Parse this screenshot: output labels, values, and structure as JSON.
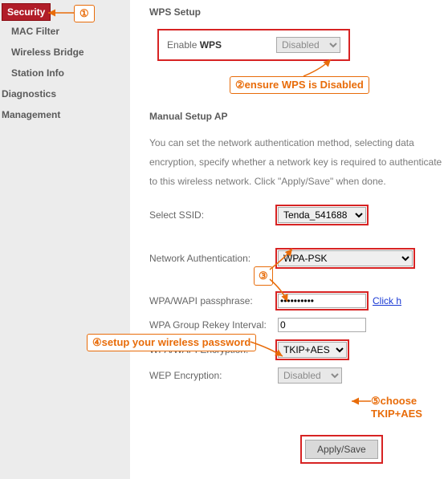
{
  "sidebar": {
    "items": [
      {
        "label": "Security",
        "active": true
      },
      {
        "label": "MAC Filter"
      },
      {
        "label": "Wireless Bridge"
      },
      {
        "label": "Station Info"
      },
      {
        "label": "Diagnostics",
        "top": true
      },
      {
        "label": "Management",
        "top": true
      }
    ]
  },
  "wps": {
    "heading": "WPS Setup",
    "enable_label_prefix": "Enable ",
    "enable_label_bold": "WPS",
    "select_value": "Disabled"
  },
  "manual": {
    "heading": "Manual Setup AP",
    "body": "You can set the network authentication method, selecting data encryption, specify whether a network key is required to authenticate to this wireless network. Click \"Apply/Save\" when done."
  },
  "form": {
    "ssid_label": "Select SSID:",
    "ssid_value": "Tenda_541688",
    "auth_label": "Network Authentication:",
    "auth_value": "WPA-PSK",
    "pass_label": "WPA/WAPI passphrase:",
    "pass_value": "••••••••••",
    "pass_hint": "Click h",
    "rekey_label": "WPA Group Rekey Interval:",
    "rekey_value": "0",
    "enc_label": "WPA/WAPI Encryption:",
    "enc_value": "TKIP+AES",
    "wep_label": "WEP Encryption:",
    "wep_value": "Disabled"
  },
  "apply_label": "Apply/Save",
  "annotations": {
    "step1": "①",
    "step2_text": "②ensure WPS is Disabled",
    "step3": "③",
    "step4_text": "④setup your wireless password",
    "step5_text": "⑤choose TKIP+AES"
  }
}
